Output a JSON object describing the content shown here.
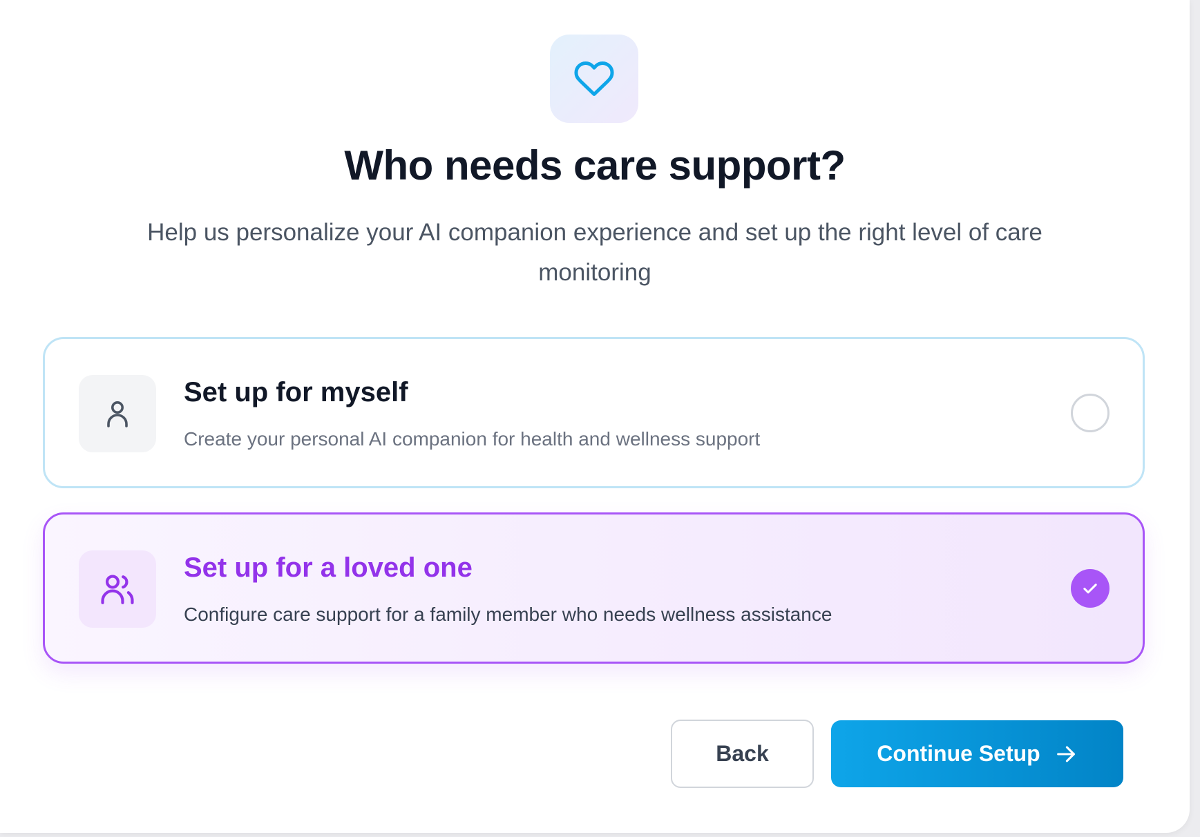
{
  "header": {
    "icon": "heart-icon",
    "title": "Who needs care support?",
    "subtitle": "Help us personalize your AI companion experience and set up the right level of care monitoring"
  },
  "options": [
    {
      "icon": "user-icon",
      "title": "Set up for myself",
      "description": "Create your personal AI companion for health and wellness support",
      "selected": false
    },
    {
      "icon": "users-icon",
      "title": "Set up for a loved one",
      "description": "Configure care support for a family member who needs wellness assistance",
      "selected": true
    }
  ],
  "actions": {
    "back_label": "Back",
    "continue_label": "Continue Setup",
    "continue_icon": "arrow-right-icon"
  },
  "colors": {
    "primary_blue": "#0ea5e9",
    "selected_purple": "#a855f7",
    "title_text": "#111827"
  }
}
